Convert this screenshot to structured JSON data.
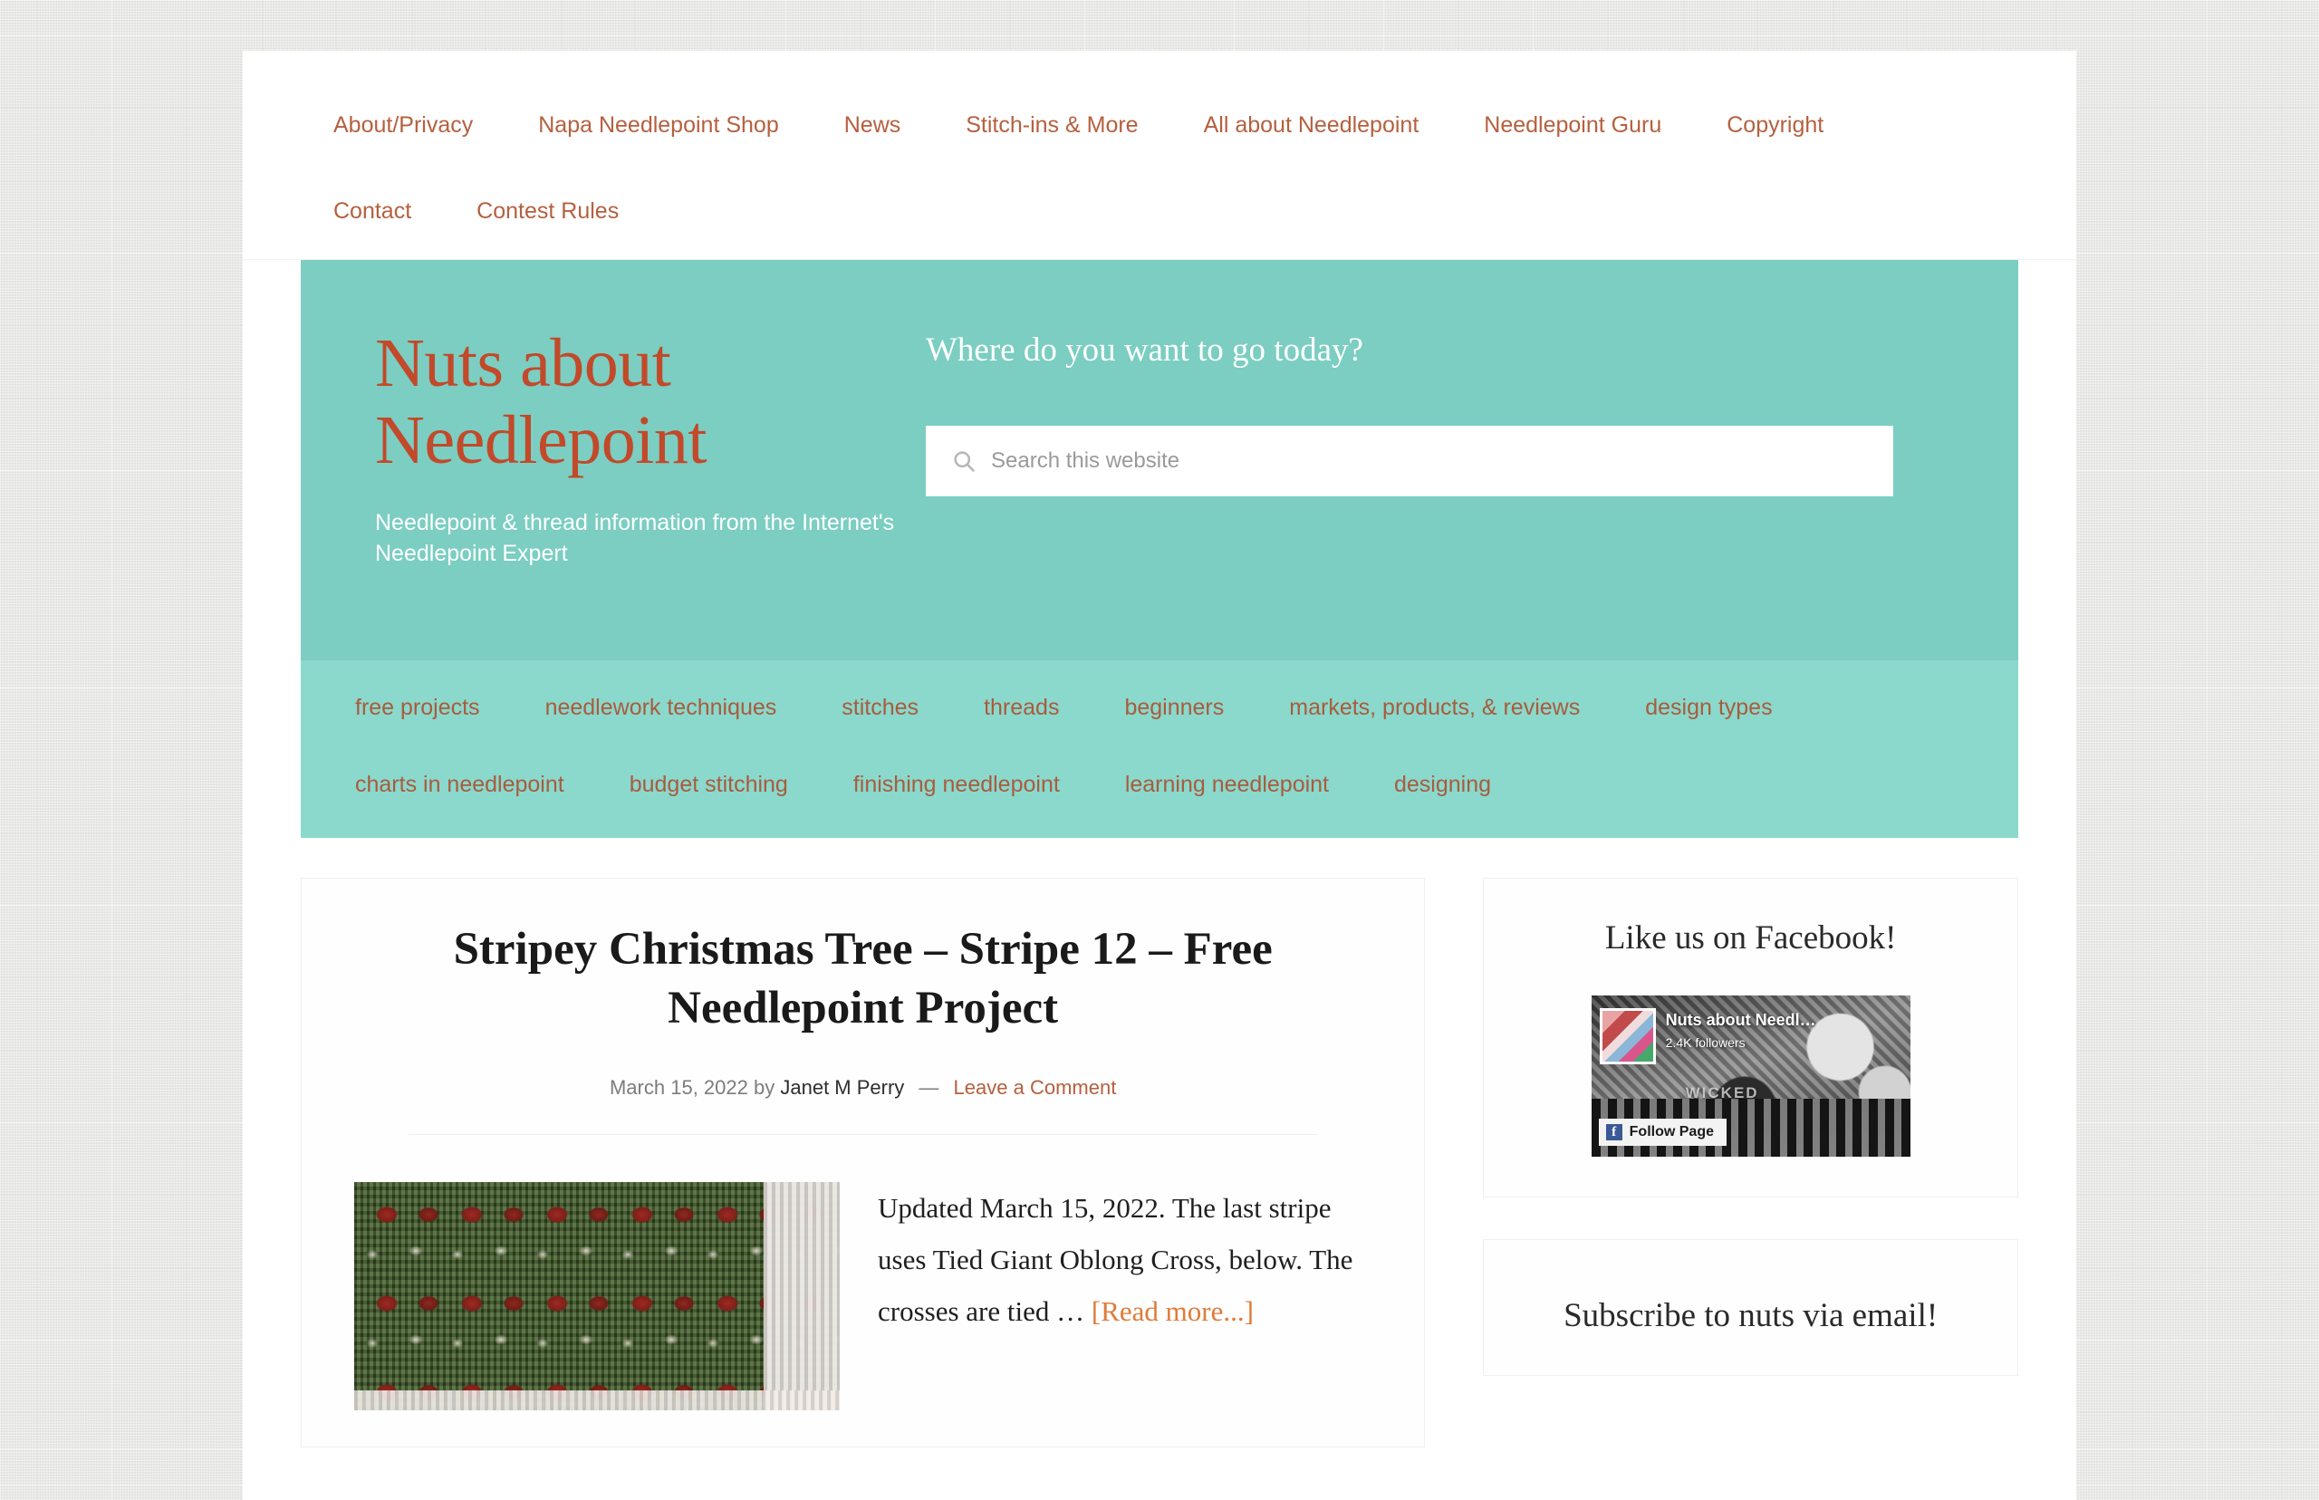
{
  "theme": {
    "accent_link": "#b5603f",
    "teal_header": "#7bcec1",
    "teal_subnav": "#8bd8cc",
    "site_title_color": "#c2492a",
    "read_more_color": "#e07b39",
    "page_background": "#e9e9e5"
  },
  "top_nav": {
    "row1": [
      {
        "label": "About/Privacy"
      },
      {
        "label": "Napa Needlepoint Shop"
      },
      {
        "label": "News"
      },
      {
        "label": "Stitch-ins & More"
      },
      {
        "label": "All about Needlepoint"
      },
      {
        "label": "Needlepoint Guru"
      },
      {
        "label": "Copyright"
      }
    ],
    "row2": [
      {
        "label": "Contact"
      },
      {
        "label": "Contest Rules"
      }
    ]
  },
  "masthead": {
    "site_title": "Nuts about Needlepoint",
    "tagline": "Needlepoint & thread information from the Internet's Needlepoint Expert",
    "search_heading": "Where do you want to go today?",
    "search_placeholder": "Search this website",
    "search_value": "",
    "search_icon": "search-icon"
  },
  "sub_nav": {
    "row1": [
      {
        "label": "free projects"
      },
      {
        "label": "needlework techniques"
      },
      {
        "label": "stitches"
      },
      {
        "label": "threads"
      },
      {
        "label": "beginners"
      },
      {
        "label": "markets, products, & reviews"
      },
      {
        "label": "design types"
      }
    ],
    "row2": [
      {
        "label": "charts in needlepoint"
      },
      {
        "label": "budget stitching"
      },
      {
        "label": "finishing needlepoint"
      },
      {
        "label": "learning needlepoint"
      },
      {
        "label": "designing"
      }
    ]
  },
  "article": {
    "title": "Stripey Christmas Tree – Stripe 12 – Free Needlepoint Project",
    "date": "March 15, 2022",
    "by_label": "by",
    "author": "Janet M Perry",
    "dash": "—",
    "comment_link": "Leave a Comment",
    "excerpt": "Updated March 15, 2022. The last stripe uses Tied Giant Oblong Cross, below. The crosses are tied … ",
    "read_more": "[Read more...]",
    "thumbnail_alt": "needlepoint-canvas-thumbnail"
  },
  "sidebar": {
    "facebook_widget": {
      "title": "Like us on Facebook!",
      "page_name": "Nuts about Needl…",
      "followers": "2.4K followers",
      "cover_text": "WICKED",
      "follow_button": "Follow Page",
      "facebook_glyph": "f"
    },
    "subscribe_widget": {
      "title": "Subscribe to nuts via email!"
    }
  }
}
